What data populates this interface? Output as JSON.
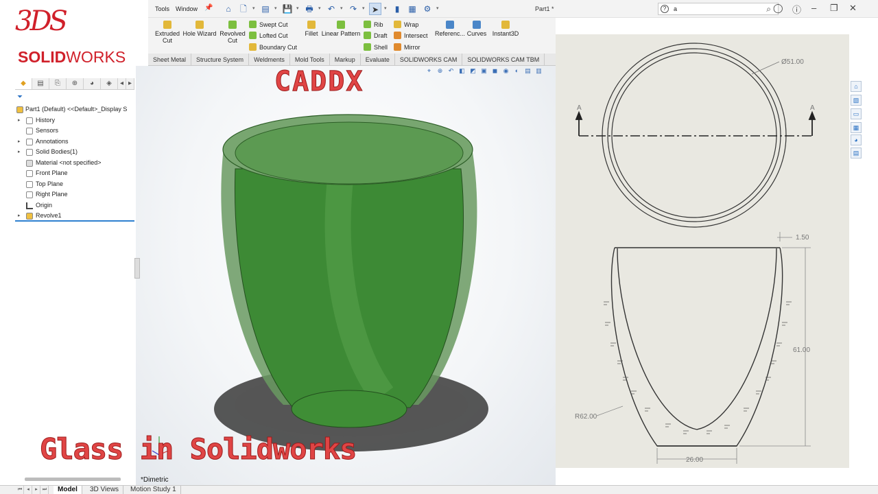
{
  "brand": {
    "mark": "3DS",
    "word_prefix": "SOLID",
    "word_suffix": "WORKS",
    "color": "#d0202a"
  },
  "menubar": {
    "tools": "Tools",
    "window": "Window",
    "pin": "📌",
    "document_title": "Part1 *",
    "search_help_icon": "?",
    "search_value": "a",
    "search_icon": "⌕"
  },
  "quick_access": [
    "⌂",
    "🗋",
    "▤",
    "💾",
    "🖶",
    "↶",
    "↷",
    "➤",
    "▮",
    "▦",
    "⚙"
  ],
  "ribbon": {
    "extruded_cut": "Extruded Cut",
    "hole_wizard": "Hole Wizard",
    "revolved_cut": "Revolved Cut",
    "swept_cut": "Swept Cut",
    "lofted_cut": "Lofted Cut",
    "boundary_cut": "Boundary Cut",
    "fillet": "Fillet",
    "linear_pattern": "Linear Pattern",
    "rib": "Rib",
    "draft": "Draft",
    "shell": "Shell",
    "wrap": "Wrap",
    "intersect": "Intersect",
    "mirror": "Mirror",
    "reference": "Referenc...",
    "curves": "Curves",
    "instant3d": "Instant3D",
    "dropdown": "-"
  },
  "command_tabs": [
    "Sheet Metal",
    "Structure System",
    "Weldments",
    "Mold Tools",
    "Markup",
    "Evaluate",
    "SOLIDWORKS CAM",
    "SOLIDWORKS CAM TBM"
  ],
  "feature_tree": {
    "part": "Part1 (Default) <<Default>_Display S",
    "history": "History",
    "sensors": "Sensors",
    "annotations": "Annotations",
    "solid_bodies": "Solid Bodies(1)",
    "material": "Material <not specified>",
    "front_plane": "Front Plane",
    "top_plane": "Top Plane",
    "right_plane": "Right Plane",
    "origin": "Origin",
    "revolve": "Revolve1"
  },
  "viewport": {
    "view_name": "*Dimetric",
    "overlay_title": "CADDX",
    "overlay_caption": "Glass in Solidworks",
    "body_color": "#3d8a35"
  },
  "drawing": {
    "section_label": "A",
    "diameter": "Ø51.00",
    "wall": "1.50",
    "height": "61.00",
    "radius": "R62.00",
    "base_width": "26.00"
  },
  "bottom_tabs": {
    "model": "Model",
    "views3d": "3D Views",
    "motion": "Motion Study 1"
  }
}
